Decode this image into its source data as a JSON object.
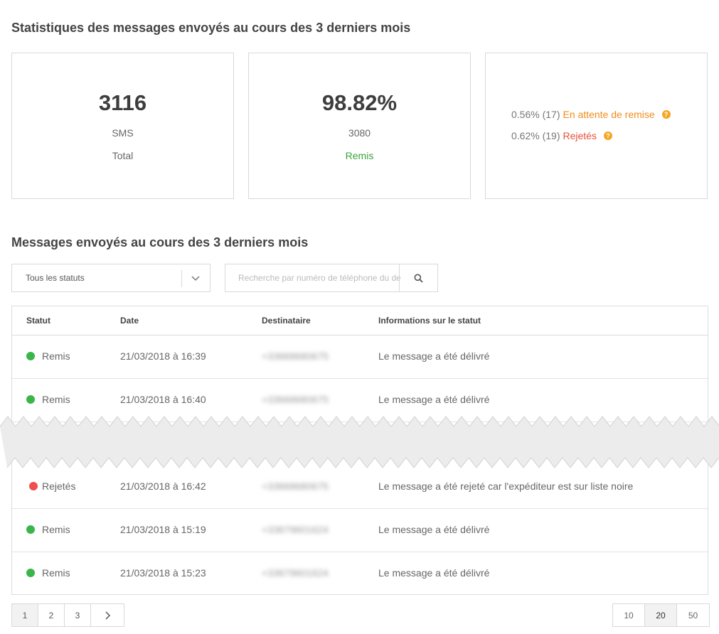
{
  "stats_title": "Statistiques des messages envoyés au cours des 3 derniers mois",
  "cards": {
    "total": {
      "value": "3116",
      "unit": "SMS",
      "label": "Total"
    },
    "delivered": {
      "value": "98.82%",
      "count": "3080",
      "label": "Remis"
    },
    "pending": {
      "text": "0.56% (17)",
      "label": "En attente de remise"
    },
    "rejected": {
      "text": "0.62% (19)",
      "label": "Rejetés"
    }
  },
  "messages_title": "Messages envoyés au cours des 3 derniers mois",
  "filter": {
    "selected": "Tous les statuts"
  },
  "search": {
    "placeholder": "Recherche par numéro de téléphone du destinataire"
  },
  "table": {
    "headers": {
      "status": "Statut",
      "date": "Date",
      "recipient": "Destinataire",
      "info": "Informations sur le statut"
    },
    "rows": [
      {
        "status": "Remis",
        "date": "21/03/2018 à 16:39",
        "recipient": "+33668680675",
        "info": "Le message a été délivré"
      },
      {
        "status": "Remis",
        "date": "21/03/2018 à 16:40",
        "recipient": "+33668680675",
        "info": "Le message a été délivré"
      },
      {
        "status": "Rejetés",
        "date": "21/03/2018 à 16:42",
        "recipient": "+33668680675",
        "info": "Le message a été rejeté car l'expéditeur est sur liste noire"
      },
      {
        "status": "Remis",
        "date": "21/03/2018 à 15:19",
        "recipient": "+33679601624",
        "info": "Le message a été délivré"
      },
      {
        "status": "Remis",
        "date": "21/03/2018 à 15:23",
        "recipient": "+33679601624",
        "info": "Le message a été délivré"
      }
    ]
  },
  "pagination": {
    "pages": [
      "1",
      "2",
      "3"
    ],
    "current": "1",
    "next_icon": "chevron-right-icon"
  },
  "page_size": {
    "options": [
      "10",
      "20",
      "50"
    ],
    "selected": "20"
  },
  "colors": {
    "delivered": "#3ab54a",
    "rejected": "#ee4f4f",
    "pending": "#f08c1a",
    "help": "#f5a623"
  }
}
